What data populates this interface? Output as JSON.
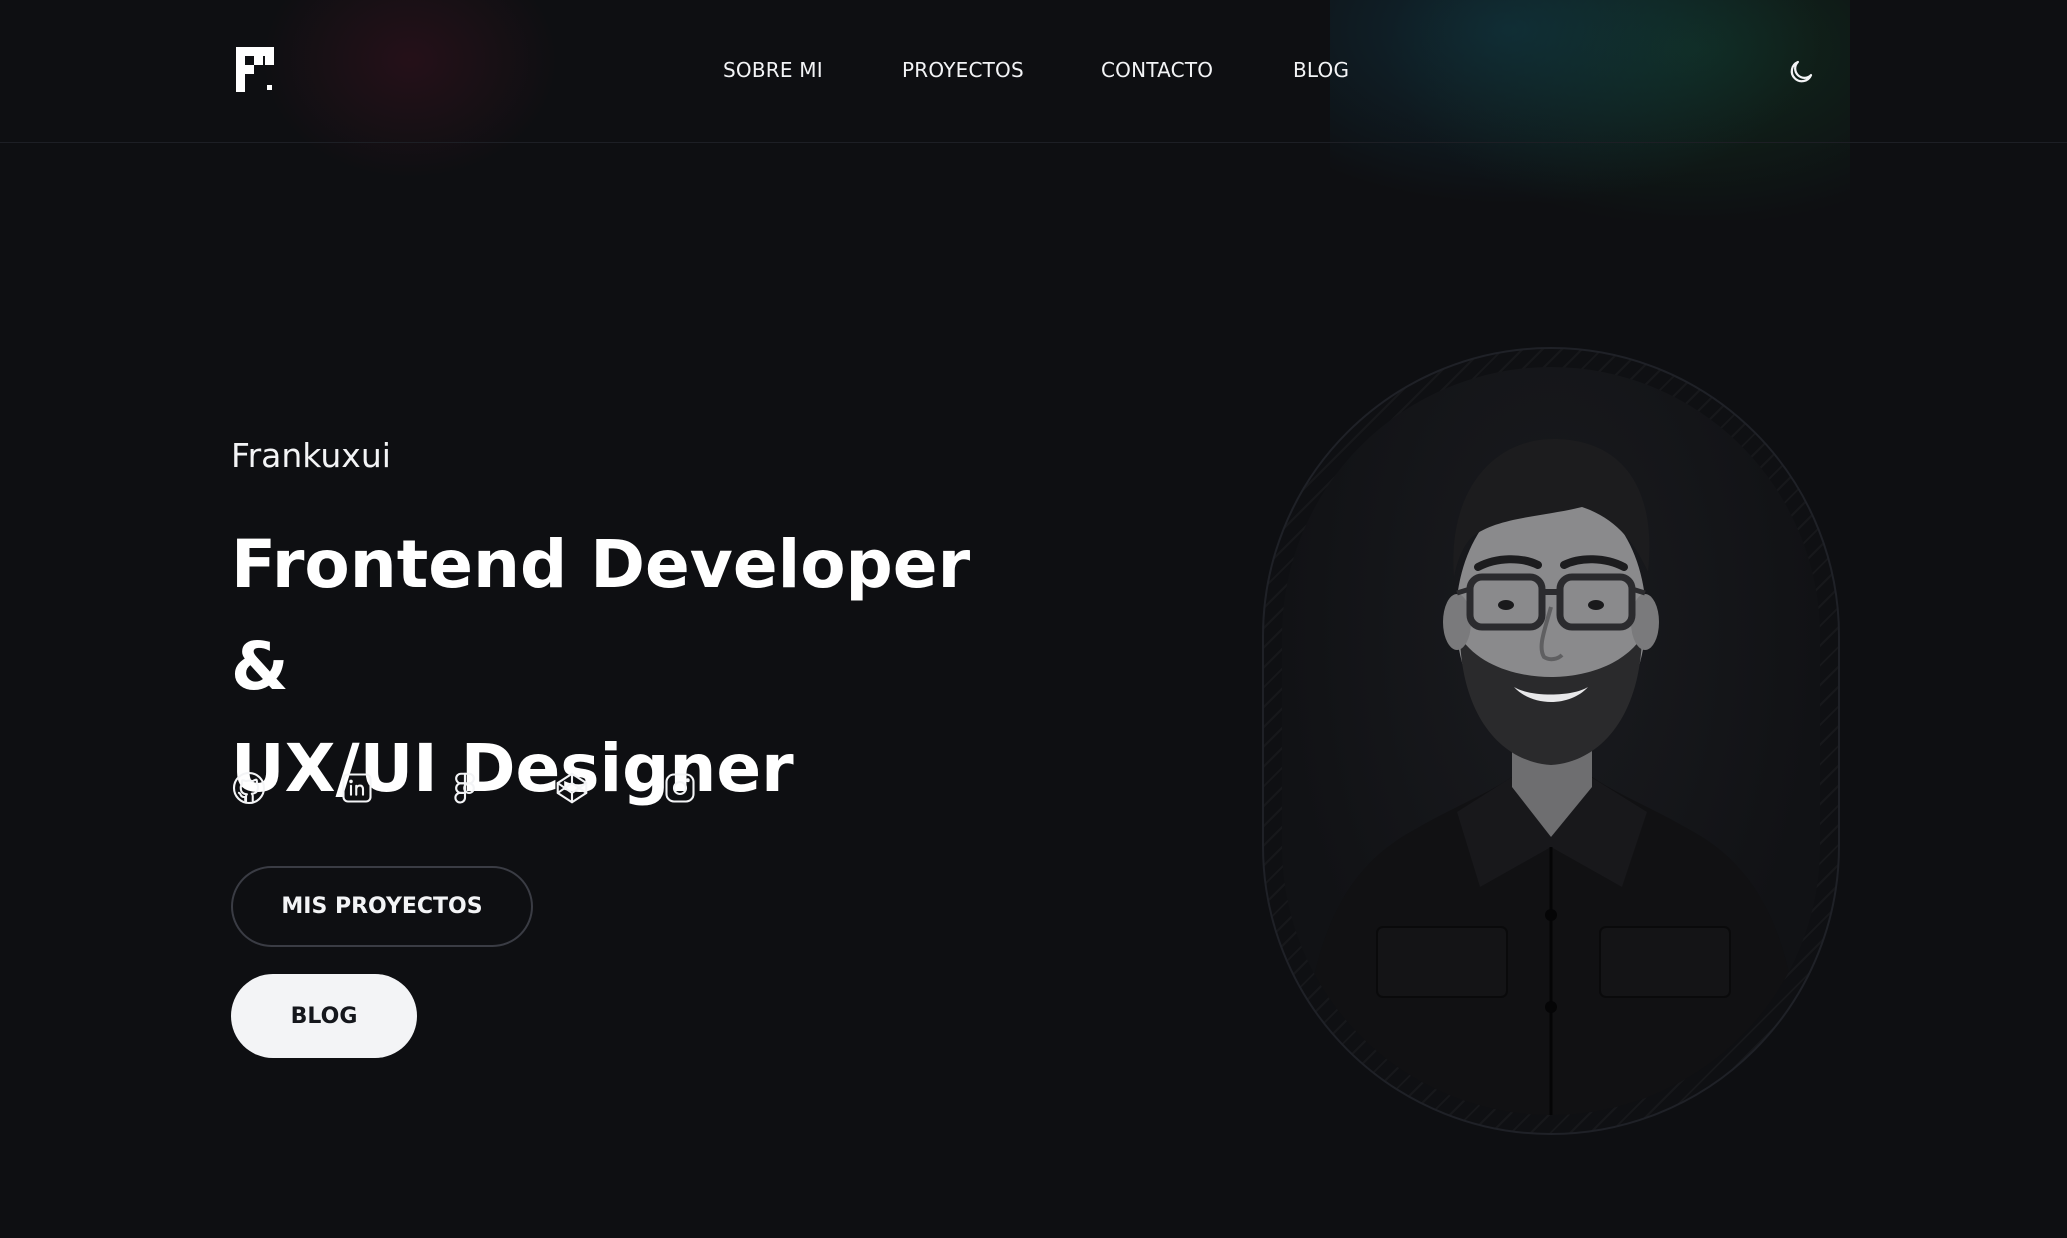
{
  "header": {
    "logo_name": "frankuxui-logo",
    "nav": [
      {
        "label": "SOBRE MI"
      },
      {
        "label": "PROYECTOS"
      },
      {
        "label": "CONTACTO"
      },
      {
        "label": "BLOG"
      }
    ],
    "theme_icon": "moon-icon"
  },
  "hero": {
    "eyebrow": "Frankuxui",
    "title_line1": "Frontend Developer &",
    "title_line2": "UX/UI Designer",
    "social_icons": [
      "github-icon",
      "linkedin-icon",
      "figma-icon",
      "codepen-icon",
      "instagram-icon"
    ],
    "primary_button": "MIS PROYECTOS",
    "secondary_button": "BLOG"
  },
  "portrait": {
    "icon": "profile-photo"
  },
  "colors": {
    "background": "#0e0f12",
    "text": "#f3f4f6",
    "button_solid_bg": "#f3f4f6",
    "button_solid_text": "#15171c",
    "button_outline_border": "#3a3c44"
  }
}
